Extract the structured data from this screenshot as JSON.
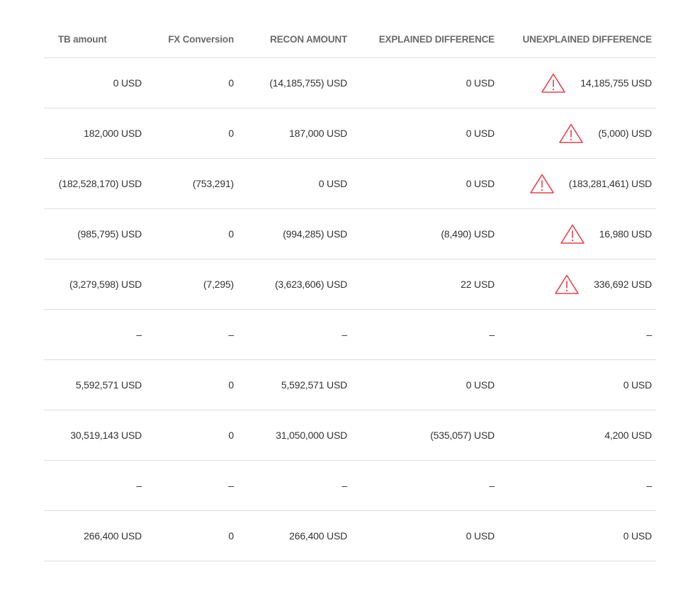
{
  "headers": [
    "TB amount",
    "FX Conversion",
    "RECON AMOUNT",
    "EXPLAINED DIFFERENCE",
    "UNEXPLAINED DIFFERENCE"
  ],
  "warning_color": "#e8404a",
  "warning_icon": "warning-triangle-icon",
  "rows": [
    {
      "tb": "0 USD",
      "fx": "0",
      "recon": "(14,185,755) USD",
      "explained": "0 USD",
      "unexplained": "14,185,755 USD",
      "warning": true
    },
    {
      "tb": "182,000 USD",
      "fx": "0",
      "recon": "187,000 USD",
      "explained": "0 USD",
      "unexplained": "(5,000) USD",
      "warning": true
    },
    {
      "tb": "(182,528,170) USD",
      "fx": "(753,291)",
      "recon": "0 USD",
      "explained": "0 USD",
      "unexplained": "(183,281,461) USD",
      "warning": true
    },
    {
      "tb": "(985,795) USD",
      "fx": "0",
      "recon": "(994,285) USD",
      "explained": "(8,490) USD",
      "unexplained": "16,980 USD",
      "warning": true
    },
    {
      "tb": "(3,279,598) USD",
      "fx": "(7,295)",
      "recon": "(3,623,606) USD",
      "explained": "22 USD",
      "unexplained": "336,692 USD",
      "warning": true
    },
    {
      "tb": "–",
      "fx": "–",
      "recon": "–",
      "explained": "–",
      "unexplained": "–",
      "warning": false
    },
    {
      "tb": "5,592,571 USD",
      "fx": "0",
      "recon": "5,592,571 USD",
      "explained": "0 USD",
      "unexplained": "0 USD",
      "warning": false
    },
    {
      "tb": "30,519,143 USD",
      "fx": "0",
      "recon": "31,050,000 USD",
      "explained": "(535,057) USD",
      "unexplained": "4,200 USD",
      "warning": false
    },
    {
      "tb": "–",
      "fx": "–",
      "recon": "–",
      "explained": "–",
      "unexplained": "–",
      "warning": false
    },
    {
      "tb": "266,400 USD",
      "fx": "0",
      "recon": "266,400 USD",
      "explained": "0 USD",
      "unexplained": "0 USD",
      "warning": false
    },
    {
      "tb": "–",
      "fx": "–",
      "recon": "–",
      "explained": "–",
      "unexplained": "–",
      "warning": false
    }
  ]
}
